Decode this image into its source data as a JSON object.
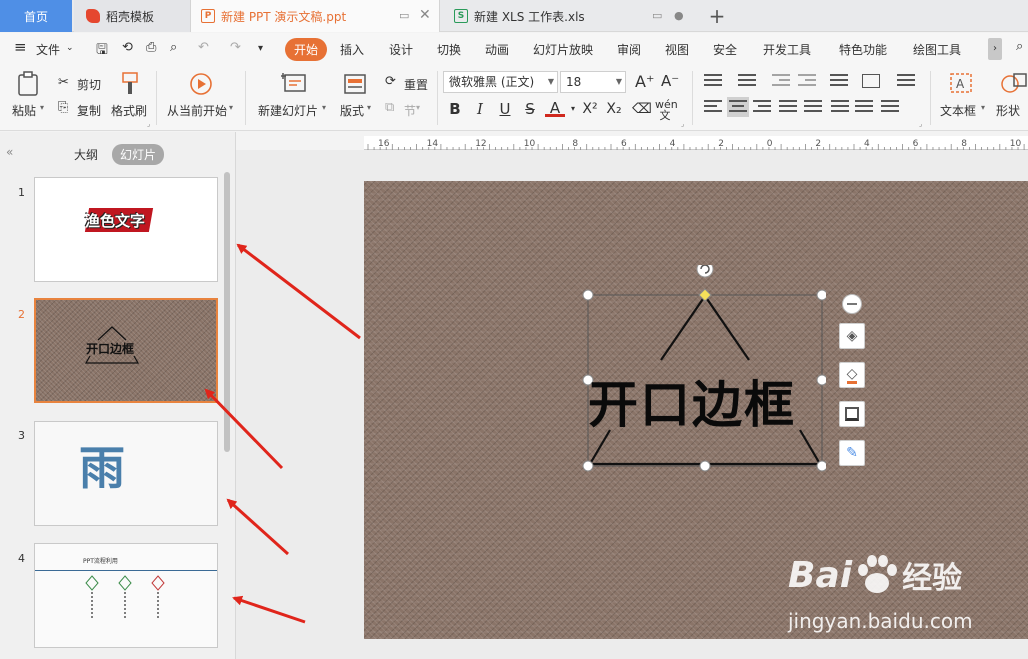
{
  "tabs": {
    "home": "首页",
    "template": "稻壳模板",
    "ppt": "新建 PPT 演示文稿.ppt",
    "xls": "新建 XLS 工作表.xls",
    "add": "+"
  },
  "menu": {
    "file": "文件",
    "items": [
      "开始",
      "插入",
      "设计",
      "切换",
      "动画",
      "幻灯片放映",
      "审阅",
      "视图",
      "安全",
      "开发工具",
      "特色功能",
      "绘图工具"
    ]
  },
  "ribbon": {
    "paste": "粘贴",
    "cut": "剪切",
    "copy": "复制",
    "format_painter": "格式刷",
    "play_from_current": "从当前开始",
    "new_slide": "新建幻灯片",
    "layout": "版式",
    "reset": "重置",
    "section": "节",
    "font_name": "微软雅黑 (正文)",
    "font_size": "18",
    "text_box": "文本框",
    "shape": "形状"
  },
  "panel": {
    "outline_tab": "大纲",
    "slides_tab": "幻灯片",
    "slides": [
      {
        "num": "1",
        "text": "渔色文字"
      },
      {
        "num": "2",
        "text": "开口边框"
      },
      {
        "num": "3",
        "text": "雨"
      },
      {
        "num": "4",
        "text": "PPT流程利用"
      }
    ]
  },
  "ruler": {
    "labels": [
      "16",
      "14",
      "12",
      "10",
      "8",
      "6",
      "4",
      "2",
      "0",
      "2",
      "4",
      "6",
      "8",
      "10",
      "12"
    ]
  },
  "slide": {
    "text": "开口边框"
  },
  "watermark": {
    "brand": "Bai",
    "brand2": "经验",
    "url": "jingyan.baidu.com"
  },
  "colors": {
    "accent": "#e77135",
    "home_tab": "#4f8fe6",
    "arrow": "#e0251b",
    "slide_bg": "#8a7468"
  }
}
